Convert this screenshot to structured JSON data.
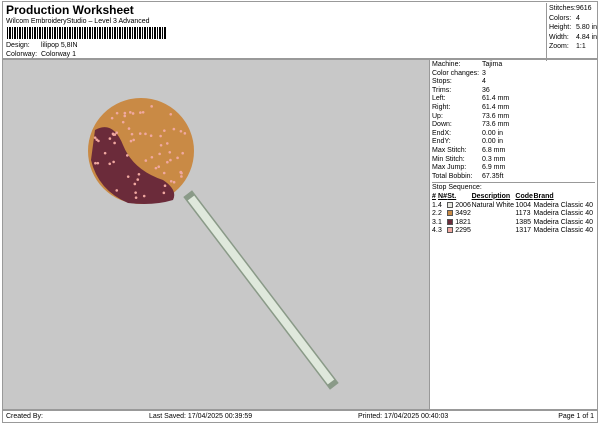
{
  "header": {
    "title": "Production Worksheet",
    "subtitle": "Wilcom EmbroideryStudio – Level 3 Advanced",
    "design_label": "Design:",
    "design": "lilipop 5,8IN",
    "colorway_label": "Colorway:",
    "colorway": "Colorway 1"
  },
  "stats": [
    {
      "k": "Stitches:",
      "v": "9616"
    },
    {
      "k": "Colors:",
      "v": "4"
    },
    {
      "k": "Height:",
      "v": "5.80 in"
    },
    {
      "k": "Width:",
      "v": "4.84 in"
    },
    {
      "k": "Zoom:",
      "v": "1:1"
    }
  ],
  "info": [
    {
      "k": "Machine:",
      "v": "Tajima"
    },
    {
      "k": "Color changes:",
      "v": "3"
    },
    {
      "k": "Stops:",
      "v": "4"
    },
    {
      "k": "Trims:",
      "v": "36"
    },
    {
      "k": "Left:",
      "v": "61.4 mm"
    },
    {
      "k": "Right:",
      "v": "61.4 mm"
    },
    {
      "k": "Up:",
      "v": "73.6 mm"
    },
    {
      "k": "Down:",
      "v": "73.6 mm"
    },
    {
      "k": "EndX:",
      "v": "0.00 in"
    },
    {
      "k": "EndY:",
      "v": "0.00 in"
    },
    {
      "k": "Max Stitch:",
      "v": "6.8 mm"
    },
    {
      "k": "Min Stitch:",
      "v": "0.3 mm"
    },
    {
      "k": "Max Jump:",
      "v": "6.9 mm"
    },
    {
      "k": "Total Bobbin:",
      "v": "67.35ft"
    }
  ],
  "stop_sequence": {
    "label": "Stop Sequence:",
    "headers": [
      "#",
      "N#",
      "St.",
      "Description",
      "Code",
      "Brand"
    ],
    "rows": [
      {
        "n": "1.",
        "num": "4",
        "color": "#e8e8e0",
        "st": "2006",
        "desc": "Natural White",
        "code": "1004",
        "brand": "Madeira Classic 40"
      },
      {
        "n": "2.",
        "num": "2",
        "color": "#c98a45",
        "st": "3492",
        "desc": "",
        "code": "1173",
        "brand": "Madeira Classic 40"
      },
      {
        "n": "3.",
        "num": "1",
        "color": "#6b2b3a",
        "st": "1821",
        "desc": "",
        "code": "1385",
        "brand": "Madeira Classic 40"
      },
      {
        "n": "4.",
        "num": "3",
        "color": "#f0a8a0",
        "st": "2295",
        "desc": "",
        "code": "1317",
        "brand": "Madeira Classic 40"
      }
    ]
  },
  "footer": {
    "created": "Created By:",
    "saved": "Last Saved: 17/04/2025 00:39:59",
    "printed": "Printed: 17/04/2025 00:40:03",
    "page": "Page 1 of 1"
  }
}
